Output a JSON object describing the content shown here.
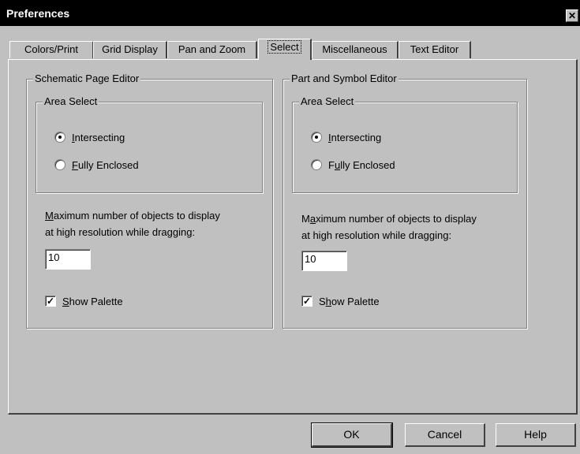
{
  "window": {
    "title": "Preferences",
    "close_glyph": "✕"
  },
  "tabs": [
    {
      "label": "Colors/Print"
    },
    {
      "label": "Grid Display"
    },
    {
      "label": "Pan and Zoom"
    },
    {
      "label": "Select"
    },
    {
      "label": "Miscellaneous"
    },
    {
      "label": "Text Editor"
    }
  ],
  "active_tab": "Select",
  "schematic": {
    "title": "Schematic Page Editor",
    "area_select_title": "Area Select",
    "intersecting": {
      "mnemonic": "I",
      "rest": "ntersecting",
      "checked": true
    },
    "fully_enclosed": {
      "mnemonic": "F",
      "rest": "ully Enclosed",
      "checked": false
    },
    "max_objects_line1_mnemonic": "M",
    "max_objects_line1_rest": "aximum number of objects to display",
    "max_objects_line2": "at high resolution while dragging:",
    "max_objects_value": "10",
    "show_palette": {
      "mnemonic": "S",
      "rest": "how Palette",
      "checked": true
    }
  },
  "part_symbol": {
    "title": "Part and Symbol Editor",
    "area_select_title": "Area Select",
    "intersecting": {
      "mnemonic": "I",
      "rest": "ntersecting",
      "checked": true
    },
    "fully_enclosed_pre": "F",
    "fully_enclosed_mnemonic": "u",
    "fully_enclosed_rest": "lly Enclosed",
    "max_objects_line1_pre": "M",
    "max_objects_line1_mnemonic": "a",
    "max_objects_line1_rest": "ximum number of objects to display",
    "max_objects_line2": "at high resolution while dragging:",
    "max_objects_value": "10",
    "show_palette_pre": "S",
    "show_palette_mnemonic": "h",
    "show_palette_rest": "ow Palette",
    "show_palette_checked": true
  },
  "buttons": {
    "ok": "OK",
    "cancel": "Cancel",
    "help": "Help"
  },
  "colors": {
    "face": "#c0c0c0",
    "titlebar": "#000000"
  }
}
